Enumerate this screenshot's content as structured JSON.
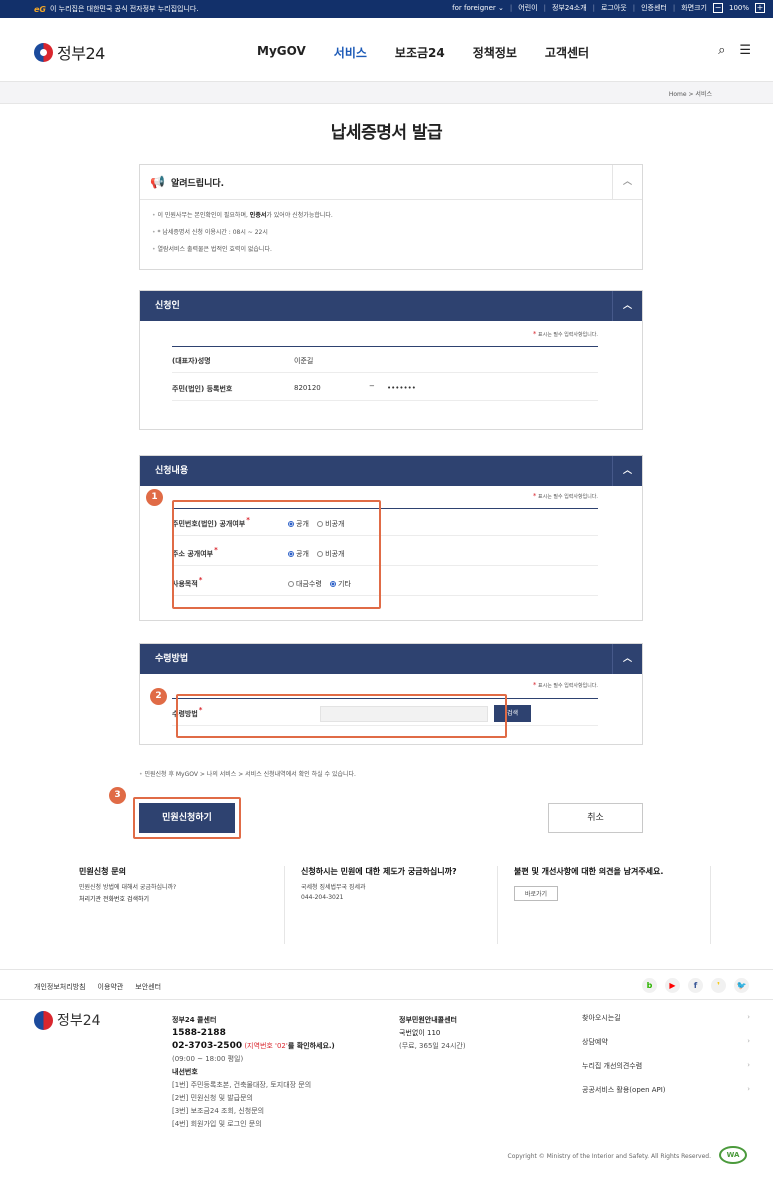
{
  "topbar": {
    "gov_mark": "eG",
    "gov_text": "이 누리집은 대한민국 공식 전자정부 누리집입니다.",
    "links": [
      "for foreigner ⌄",
      "어린이",
      "정부24소개",
      "로그아웃",
      "인증센터",
      "화면크기"
    ],
    "zoom_minus": "−",
    "zoom": "100%",
    "zoom_plus": "+"
  },
  "header": {
    "logo": "정부24",
    "nav": [
      "MyGOV",
      "서비스",
      "보조금24",
      "정책정보",
      "고객센터"
    ]
  },
  "breadcrumb": "Home > 서비스",
  "page_title": "납세증명서 발급",
  "notice": {
    "title": "알려드립니다.",
    "items": [
      "이 민원사무는 본인확인이 필요하며, 인증서가 있어야 신청가능합니다.",
      "* 납세증명서 신청 이용시간 : 08시 ~ 22시",
      "열람서비스 출력물은 법적인 효력이 없습니다."
    ]
  },
  "required_note": "표시는 필수 입력사항입니다.",
  "applicant": {
    "header": "신청인",
    "name_label": "(대표자)성명",
    "name_value": "이준길",
    "id_label": "주민(법인) 등록번호",
    "id_front": "820120",
    "id_dash": "−",
    "id_back": "•••••••"
  },
  "content": {
    "header": "신청내용",
    "rows": [
      {
        "label": "주민번호(법인) 공개여부",
        "opt1": "공개",
        "opt2": "비공개",
        "selected": 1
      },
      {
        "label": "주소 공개여부",
        "opt1": "공개",
        "opt2": "비공개",
        "selected": 1
      },
      {
        "label": "사용목적",
        "opt1": "대금수령",
        "opt2": "기타",
        "selected": 2
      }
    ]
  },
  "receive": {
    "header": "수령방법",
    "label": "수령방법",
    "search": "검색"
  },
  "tip": "민원신청 후 MyGOV > 나의 서비스 > 서비스 신청내역에서 확인 하실 수 있습니다.",
  "badges": [
    "1",
    "2",
    "3"
  ],
  "apply_button": "민원신청하기",
  "cancel_button": "취소",
  "help": {
    "c1_title": "민원신청 문의",
    "c1_line1": "민원신청 방법에 대해서 궁금하십니까?",
    "c1_line2": "처리기관 전화번호 검색하기",
    "c2_title": "신청하시는 민원에 대한 제도가 궁금하십니까?",
    "c2_line1": "국세청 징세법무국 징세과",
    "c2_line2": "044-204-3021",
    "c3_title": "불편 및 개선사항에 대한 의견을 남겨주세요.",
    "c3_button": "바로가기"
  },
  "footer": {
    "links": [
      "개인정보처리방침",
      "이용약관",
      "보안센터"
    ],
    "social": [
      "b",
      "▶",
      "f",
      "❜",
      "🐦"
    ],
    "logo": "정부24",
    "call_title": "정부24 콜센터",
    "call_num1": "1588-2188",
    "call_num2": "02-3703-2500",
    "call_num2_note": "(지역번호 '02'",
    "call_num2_tail": "를 확인하세요.)",
    "call_hours": "(09:00 ~ 18:00 평일)",
    "ext_title": "내선번호",
    "ext": [
      "[1번] 주민등록초본, 건축물대장, 토지대장 문의",
      "[2번] 민원신청 및 발급문의",
      "[3번] 보조금24 조회, 신청문의",
      "[4번] 회원가입 및 로그인 문의"
    ],
    "center_title": "정부민원안내콜센터",
    "center_num": "국번없이 110",
    "center_hours": "(무료, 365일 24시간)",
    "right_links": [
      "찾아오시는길",
      "상담예약",
      "누리집 개선의견수렴",
      "공공서비스 활용(open API)"
    ],
    "copyright": "Copyright © Ministry of the Interior and Safety. All Rights Reserved.",
    "wa_mark": "WA"
  },
  "colors": {
    "navy": "#2e4270",
    "accent": "#1c5ab7",
    "highlight": "#e06b46",
    "required": "#d9262e"
  }
}
